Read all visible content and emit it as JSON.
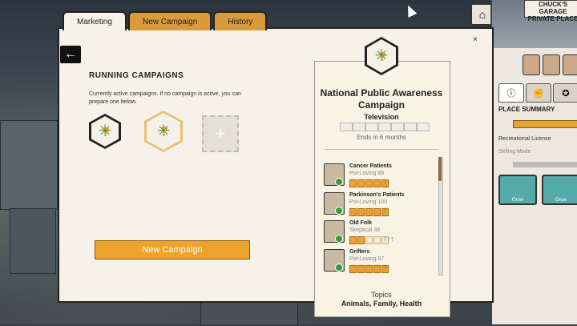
{
  "tabs": [
    {
      "label": "Marketing",
      "active": true
    },
    {
      "label": "New Campaign",
      "active": false
    },
    {
      "label": "History",
      "active": false
    }
  ],
  "close_label": "×",
  "back_label": "←",
  "running": {
    "title": "RUNNING CAMPAIGNS",
    "description": "Currently active campaigns. If no campaign is active, you can prepare one below.",
    "add_label": "+",
    "new_button": "New Campaign"
  },
  "campaign": {
    "title": "National Public Awareness Campaign",
    "medium": "Television",
    "progress_cells": 7,
    "ends": "Ends in 6 months",
    "audiences": [
      {
        "name": "Cancer Patients",
        "attitude": "Pot-Loving 86",
        "filled": 5,
        "total": 5,
        "arrows": "↑↑"
      },
      {
        "name": "Parkinson's Patients",
        "attitude": "Pot-Loving 100",
        "filled": 5,
        "total": 5,
        "arrows": "↑↑"
      },
      {
        "name": "Old Folk",
        "attitude": "Skeptical 38",
        "filled": 2,
        "total": 5,
        "arrows": "↑↑↑"
      },
      {
        "name": "Grifters",
        "attitude": "Pot-Loving 97",
        "filled": 5,
        "total": 5,
        "arrows": "↑"
      }
    ],
    "topics_label": "Topics",
    "topics": "Animals, Family, Health"
  },
  "right_panel": {
    "garage_label": "CHUCK'S GARAGE",
    "garage_sub": "PRIVATE PLACE",
    "summary": "PLACE SUMMARY",
    "license": "Recreational License",
    "selling_mode": "Selling Mode",
    "cards": [
      "Grow",
      "Grow"
    ]
  },
  "colors": {
    "accent": "#eca42c",
    "positive": "#2a9a2a",
    "leaf": "#3e9b2a"
  },
  "icons": [
    "home-icon",
    "arrow-left-icon",
    "cannabis-leaf-icon",
    "question-mark-icon",
    "plus-icon",
    "info-icon",
    "close-icon"
  ]
}
